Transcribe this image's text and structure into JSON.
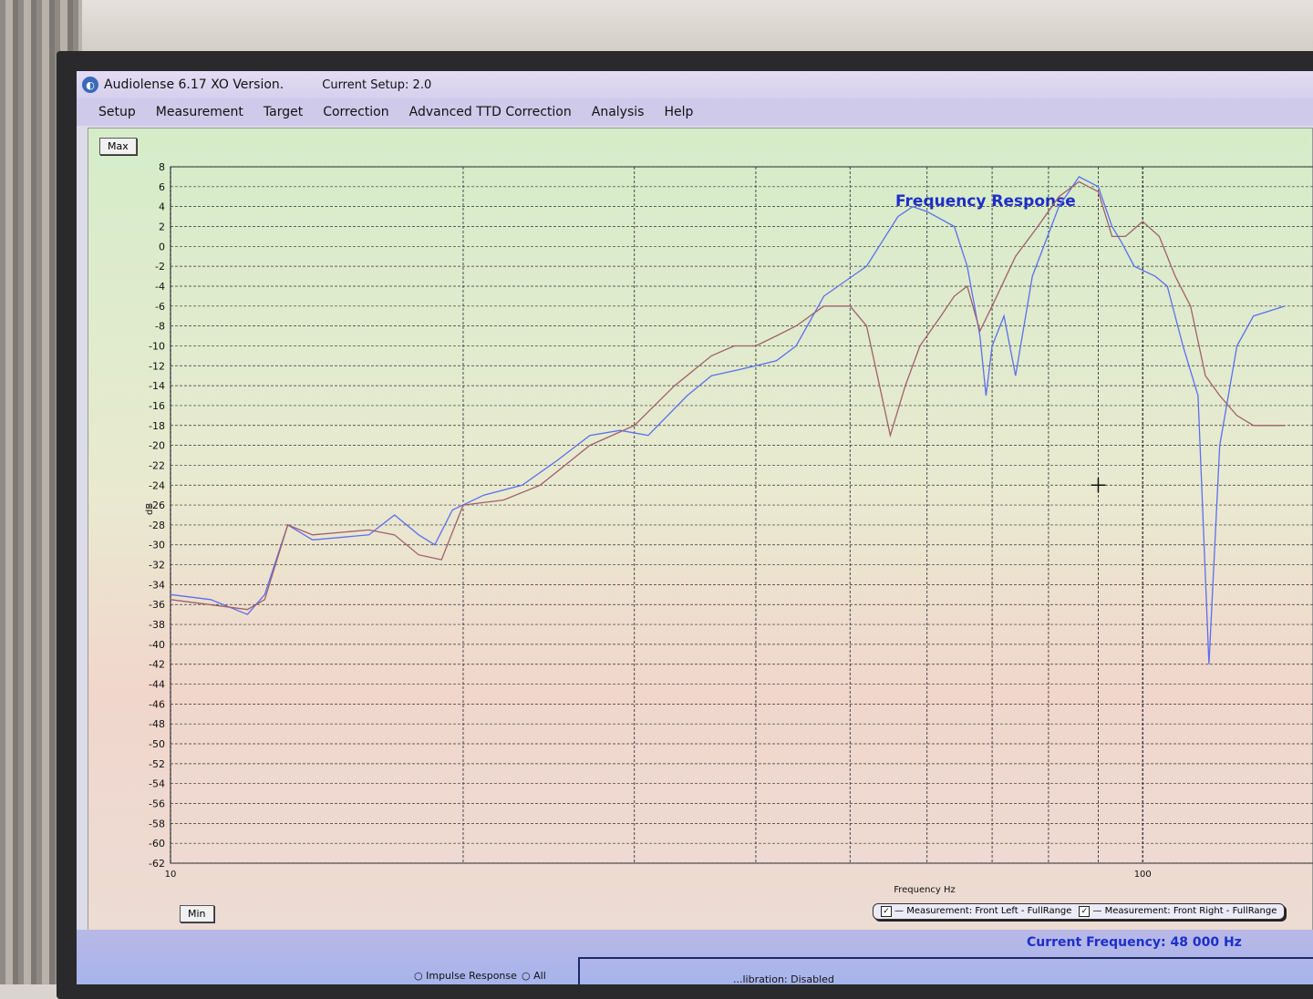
{
  "window": {
    "title": "Audiolense 6.17 XO Version.",
    "current_setup": "Current Setup: 2.0"
  },
  "menu": [
    "Setup",
    "Measurement",
    "Target",
    "Correction",
    "Advanced TTD Correction",
    "Analysis",
    "Help"
  ],
  "buttons": {
    "max": "Max",
    "min": "Min"
  },
  "status": {
    "current_frequency_label": "Current Frequency:",
    "current_frequency_value": "48 000 Hz",
    "calibration": "...libration:  Disabled"
  },
  "radios": {
    "impulse": "Impulse Response",
    "all": "All"
  },
  "colors": {
    "blue": "#5b6ff0",
    "red": "#a0606a",
    "title": "#1d2fc8"
  },
  "chart_data": {
    "type": "line",
    "title": "Frequency Response",
    "xlabel": "Frequency Hz",
    "ylabel": "dB",
    "xscale": "log",
    "xlim": [
      10,
      150
    ],
    "ylim": [
      -62,
      8
    ],
    "x_tick_labels": [
      "10",
      "100"
    ],
    "y_ticks": [
      8,
      6,
      4,
      2,
      0,
      -2,
      -4,
      -6,
      -8,
      -10,
      -12,
      -14,
      -16,
      -18,
      -20,
      -22,
      -24,
      -26,
      -28,
      -30,
      -32,
      -34,
      -36,
      -38,
      -40,
      -42,
      -44,
      -46,
      -48,
      -50,
      -52,
      -54,
      -56,
      -58,
      -60,
      -62
    ],
    "grid": true,
    "legend": [
      "Measurement: Front Left - FullRange",
      "Measurement: Front Right - FullRange"
    ],
    "legend_position": "bottom",
    "series": [
      {
        "name": "Measurement: Front Left - FullRange",
        "color": "#5b6ff0",
        "points": [
          [
            10,
            -35
          ],
          [
            11,
            -35.5
          ],
          [
            12,
            -37
          ],
          [
            12.5,
            -35
          ],
          [
            13.2,
            -28
          ],
          [
            14,
            -29.5
          ],
          [
            16,
            -29
          ],
          [
            17,
            -27
          ],
          [
            18,
            -29
          ],
          [
            18.7,
            -30
          ],
          [
            19.5,
            -26.5
          ],
          [
            21,
            -25
          ],
          [
            23,
            -24
          ],
          [
            25,
            -21.5
          ],
          [
            27,
            -19
          ],
          [
            29,
            -18.5
          ],
          [
            31,
            -19
          ],
          [
            34,
            -15
          ],
          [
            36,
            -13
          ],
          [
            38,
            -12.5
          ],
          [
            40,
            -12
          ],
          [
            42,
            -11.5
          ],
          [
            44,
            -10
          ],
          [
            47,
            -5
          ],
          [
            52,
            -2
          ],
          [
            56,
            3
          ],
          [
            58,
            4
          ],
          [
            60,
            3.5
          ],
          [
            64,
            2
          ],
          [
            66,
            -2
          ],
          [
            68,
            -9
          ],
          [
            69,
            -15
          ],
          [
            70,
            -10
          ],
          [
            72,
            -7
          ],
          [
            74,
            -13
          ],
          [
            77,
            -3
          ],
          [
            82,
            4
          ],
          [
            86,
            7
          ],
          [
            90,
            6
          ],
          [
            93,
            2
          ],
          [
            95,
            0.5
          ],
          [
            98,
            -2
          ],
          [
            103,
            -3
          ],
          [
            106,
            -4
          ],
          [
            110,
            -10
          ],
          [
            114,
            -15
          ],
          [
            117,
            -42
          ],
          [
            120,
            -20
          ],
          [
            125,
            -10
          ],
          [
            130,
            -7
          ],
          [
            140,
            -6
          ]
        ]
      },
      {
        "name": "Measurement: Front Right - FullRange",
        "color": "#a0606a",
        "points": [
          [
            10,
            -35.5
          ],
          [
            12,
            -36.5
          ],
          [
            12.5,
            -35.5
          ],
          [
            13.2,
            -28
          ],
          [
            14,
            -29
          ],
          [
            16,
            -28.5
          ],
          [
            17,
            -29
          ],
          [
            18,
            -31
          ],
          [
            19,
            -31.5
          ],
          [
            20,
            -26
          ],
          [
            22,
            -25.5
          ],
          [
            24,
            -24
          ],
          [
            27,
            -20
          ],
          [
            30,
            -18
          ],
          [
            33,
            -14
          ],
          [
            36,
            -11
          ],
          [
            38,
            -10
          ],
          [
            40,
            -10
          ],
          [
            42,
            -9
          ],
          [
            44,
            -8
          ],
          [
            47,
            -6
          ],
          [
            50,
            -6
          ],
          [
            52,
            -8
          ],
          [
            55,
            -19
          ],
          [
            57,
            -14
          ],
          [
            59,
            -10
          ],
          [
            62,
            -7
          ],
          [
            64,
            -5
          ],
          [
            66,
            -4
          ],
          [
            68,
            -8.5
          ],
          [
            70,
            -6
          ],
          [
            74,
            -1
          ],
          [
            78,
            2
          ],
          [
            82,
            5
          ],
          [
            86,
            6.5
          ],
          [
            90,
            5.5
          ],
          [
            93,
            1
          ],
          [
            96,
            1
          ],
          [
            100,
            2.5
          ],
          [
            104,
            1
          ],
          [
            108,
            -3
          ],
          [
            112,
            -6
          ],
          [
            116,
            -13
          ],
          [
            120,
            -15
          ],
          [
            125,
            -17
          ],
          [
            130,
            -18
          ],
          [
            140,
            -18
          ]
        ]
      }
    ]
  }
}
